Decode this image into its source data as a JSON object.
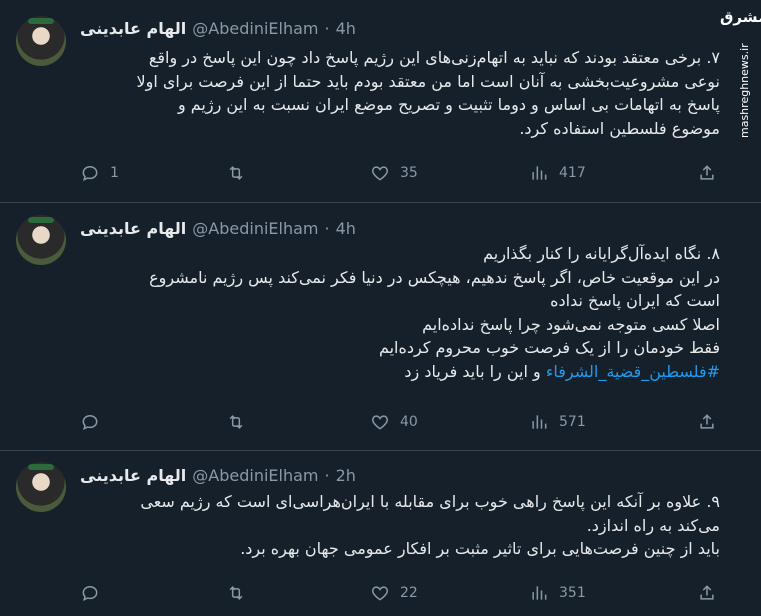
{
  "watermark": {
    "logo_text": "مشرق",
    "url": "mashreghnews.ir"
  },
  "tweets": [
    {
      "name": "الهام عابدینی",
      "handle": "@AbediniElham",
      "dot": "·",
      "time": "4h",
      "lines": [
        "۷. برخی معتقد بودند که نباید به اتهام‌زنی‌های این رژیم پاسخ داد چون این پاسخ در واقع",
        "نوعی مشروعیت‌بخشی به آنان است اما من معتقد بودم باید حتما از این فرصت برای اولا",
        "پاسخ به اتهامات بی اساس و دوما تثبیت و تصریح موضع ایران نسبت به این رژیم و",
        "موضوع فلسطین استفاده کرد."
      ],
      "stats": {
        "replies": "1",
        "retweets": "",
        "likes": "35",
        "views": "417"
      }
    },
    {
      "name": "الهام عابدینی",
      "handle": "@AbediniElham",
      "dot": "·",
      "time": "4h",
      "lines": [
        "۸. نگاه ایده‌آل‌گرایانه را کنار بگذاریم",
        "در این موقعیت خاص، اگر پاسخ ندهیم، هیچکس در دنیا فکر نمی‌کند پس رژیم نامشروع",
        "است که ایران پاسخ نداده",
        "اصلا کسی متوجه نمی‌شود چرا پاسخ نداده‌ایم",
        "فقط خودمان را از یک فرصت خوب محروم کرده‌ایم"
      ],
      "hashtag": "#فلسطین_قضیة_الشرفاء",
      "hashtag_suffix": " و این را باید فریاد زد",
      "stats": {
        "replies": "",
        "retweets": "",
        "likes": "40",
        "views": "571"
      }
    },
    {
      "name": "الهام عابدینی",
      "handle": "@AbediniElham",
      "dot": "·",
      "time": "2h",
      "lines": [
        "۹. علاوه بر آنکه این پاسخ راهی خوب برای مقابله با ایران‌هراسی‌ای است که رژیم سعی",
        "می‌کند به راه اندازد.",
        "باید از چنین فرصت‌هایی برای تاثیر مثبت بر افکار عمومی جهان بهره برد."
      ],
      "stats": {
        "replies": "",
        "retweets": "",
        "likes": "22",
        "views": "351"
      }
    }
  ]
}
